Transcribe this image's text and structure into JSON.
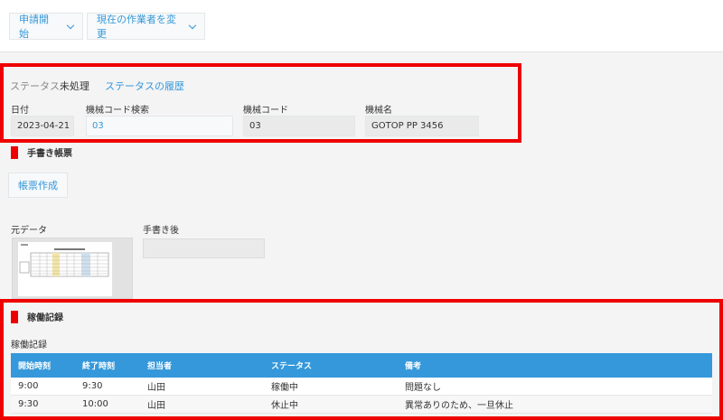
{
  "toolbar": {
    "start_request": "申請開始",
    "change_assignee": "現在の作業者を変更"
  },
  "status": {
    "label": "ステータス:",
    "value": "未処理",
    "history_link": "ステータスの履歴"
  },
  "fields": {
    "date": {
      "label": "日付",
      "value": "2023-04-21"
    },
    "machine_code_search": {
      "label": "機械コード検索",
      "value": "03"
    },
    "machine_code": {
      "label": "機械コード",
      "value": "03"
    },
    "machine_name": {
      "label": "機械名",
      "value": "GOTOP PP 3456"
    }
  },
  "handwritten_section": {
    "title": "手書き帳票",
    "create_button": "帳票作成",
    "original_label": "元データ",
    "after_label": "手書き後"
  },
  "operation_section": {
    "title": "稼働記録",
    "table_label": "稼働記録",
    "columns": [
      "開始時刻",
      "終了時刻",
      "担当者",
      "ステータス",
      "備考"
    ],
    "rows": [
      [
        "9:00",
        "9:30",
        "山田",
        "稼働中",
        "問題なし"
      ],
      [
        "9:30",
        "10:00",
        "山田",
        "休止中",
        "異常ありのため、一旦休止"
      ]
    ]
  },
  "colors": {
    "accent": "#3498db",
    "highlight": "#ee0000",
    "table_header": "#3498db"
  }
}
